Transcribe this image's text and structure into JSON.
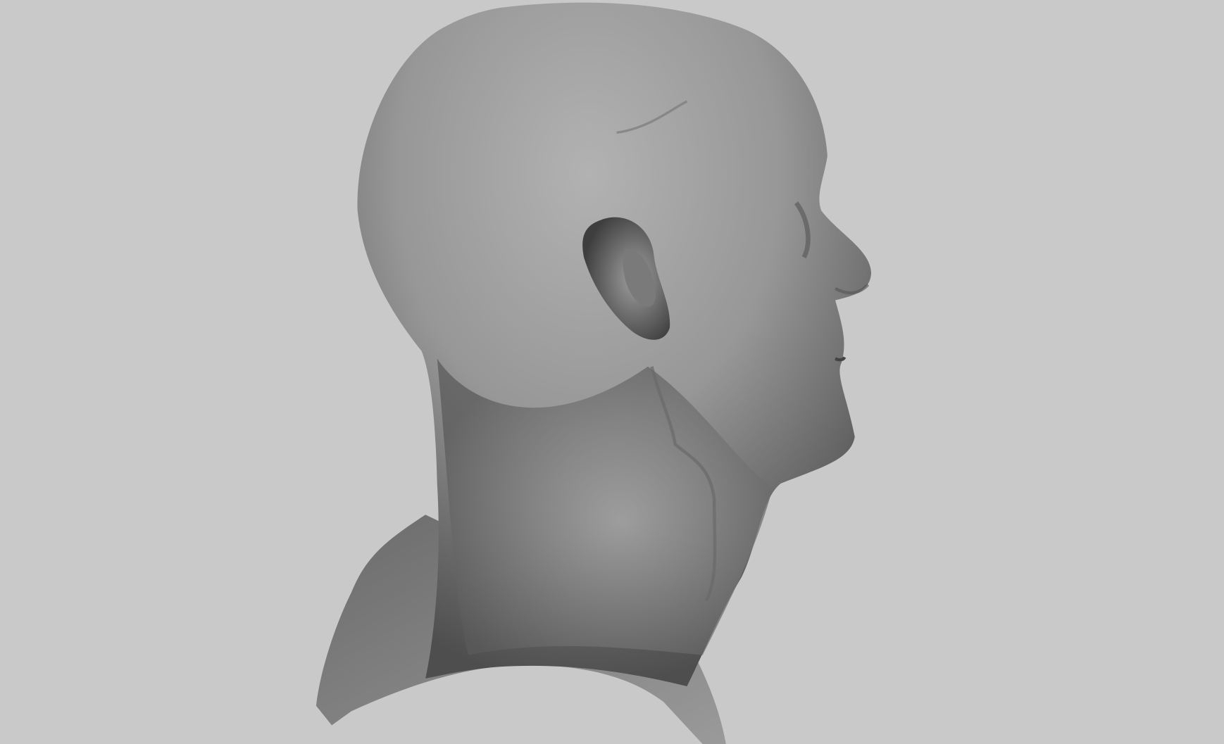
{
  "scene": {
    "subject": "sculpted-head-profile",
    "colors": {
      "background": "#c9c9c9",
      "model_base": "#8c8c8c",
      "model_highlight": "#b4b4b4",
      "model_shadow": "#4a4a4a"
    }
  }
}
